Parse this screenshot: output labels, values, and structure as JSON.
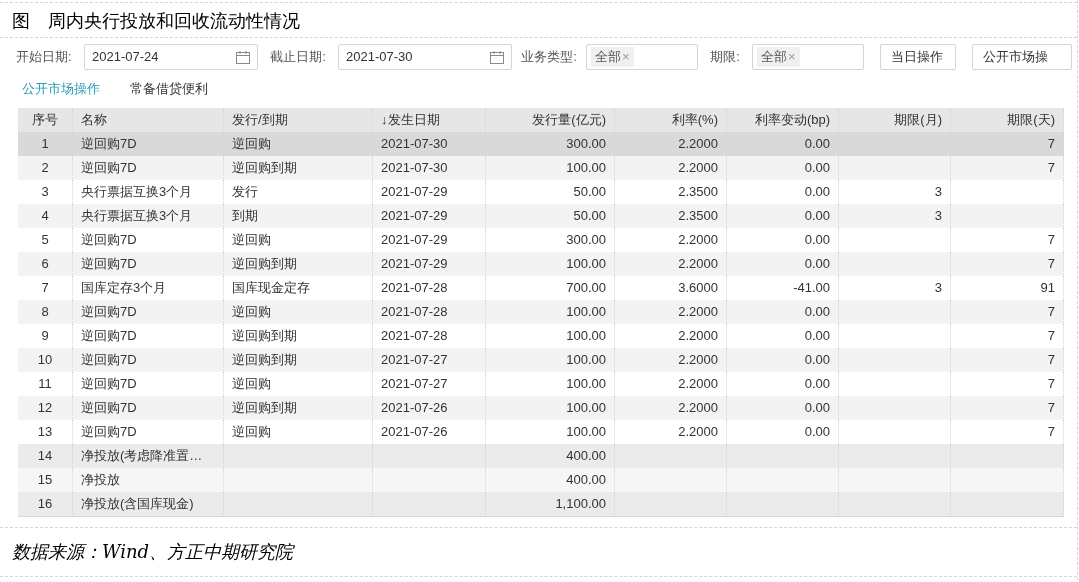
{
  "caption": "图　周内央行投放和回收流动性情况",
  "filters": [
    {
      "kind": "date",
      "label": "开始日期:",
      "value": "2021-07-24"
    },
    {
      "kind": "date",
      "label": "截止日期:",
      "value": "2021-07-30"
    },
    {
      "kind": "tag",
      "label": "业务类型:",
      "value": "全部",
      "remove": "×"
    },
    {
      "kind": "tag",
      "label": "期限:",
      "value": "全部",
      "remove": "×"
    }
  ],
  "buttons": [
    "当日操作",
    "公开市场操"
  ],
  "tabs": [
    {
      "label": "公开市场操作",
      "selected": true
    },
    {
      "label": "常备借贷便利",
      "selected": false
    }
  ],
  "table": {
    "columns": [
      "序号",
      "名称",
      "发行/到期",
      "↓发生日期",
      "发行量(亿元)",
      "利率(%)",
      "利率变动(bp)",
      "期限(月)",
      "期限(天)"
    ],
    "rows": [
      {
        "kind": "data",
        "selected": true,
        "cells": [
          "1",
          "逆回购7D",
          "逆回购",
          "2021-07-30",
          "300.00",
          "2.2000",
          "0.00",
          "",
          "7"
        ]
      },
      {
        "kind": "data",
        "selected": false,
        "cells": [
          "2",
          "逆回购7D",
          "逆回购到期",
          "2021-07-30",
          "100.00",
          "2.2000",
          "0.00",
          "",
          "7"
        ]
      },
      {
        "kind": "data",
        "selected": false,
        "cells": [
          "3",
          "央行票据互换3个月",
          "发行",
          "2021-07-29",
          "50.00",
          "2.3500",
          "0.00",
          "3",
          ""
        ]
      },
      {
        "kind": "data",
        "selected": false,
        "cells": [
          "4",
          "央行票据互换3个月",
          "到期",
          "2021-07-29",
          "50.00",
          "2.3500",
          "0.00",
          "3",
          ""
        ]
      },
      {
        "kind": "data",
        "selected": false,
        "cells": [
          "5",
          "逆回购7D",
          "逆回购",
          "2021-07-29",
          "300.00",
          "2.2000",
          "0.00",
          "",
          "7"
        ]
      },
      {
        "kind": "data",
        "selected": false,
        "cells": [
          "6",
          "逆回购7D",
          "逆回购到期",
          "2021-07-29",
          "100.00",
          "2.2000",
          "0.00",
          "",
          "7"
        ]
      },
      {
        "kind": "data",
        "selected": false,
        "cells": [
          "7",
          "国库定存3个月",
          "国库现金定存",
          "2021-07-28",
          "700.00",
          "3.6000",
          "-41.00",
          "3",
          "91"
        ]
      },
      {
        "kind": "data",
        "selected": false,
        "cells": [
          "8",
          "逆回购7D",
          "逆回购",
          "2021-07-28",
          "100.00",
          "2.2000",
          "0.00",
          "",
          "7"
        ]
      },
      {
        "kind": "data",
        "selected": false,
        "cells": [
          "9",
          "逆回购7D",
          "逆回购到期",
          "2021-07-28",
          "100.00",
          "2.2000",
          "0.00",
          "",
          "7"
        ]
      },
      {
        "kind": "data",
        "selected": false,
        "cells": [
          "10",
          "逆回购7D",
          "逆回购到期",
          "2021-07-27",
          "100.00",
          "2.2000",
          "0.00",
          "",
          "7"
        ]
      },
      {
        "kind": "data",
        "selected": false,
        "cells": [
          "11",
          "逆回购7D",
          "逆回购",
          "2021-07-27",
          "100.00",
          "2.2000",
          "0.00",
          "",
          "7"
        ]
      },
      {
        "kind": "data",
        "selected": false,
        "cells": [
          "12",
          "逆回购7D",
          "逆回购到期",
          "2021-07-26",
          "100.00",
          "2.2000",
          "0.00",
          "",
          "7"
        ]
      },
      {
        "kind": "data",
        "selected": false,
        "cells": [
          "13",
          "逆回购7D",
          "逆回购",
          "2021-07-26",
          "100.00",
          "2.2000",
          "0.00",
          "",
          "7"
        ]
      },
      {
        "kind": "summary",
        "selected": false,
        "cells": [
          "14",
          "净投放(考虑降准置…",
          "",
          "",
          "400.00",
          "",
          "",
          "",
          ""
        ]
      },
      {
        "kind": "summary",
        "selected": false,
        "cells": [
          "15",
          "净投放",
          "",
          "",
          "400.00",
          "",
          "",
          "",
          ""
        ]
      },
      {
        "kind": "summary",
        "selected": false,
        "cells": [
          "16",
          "净投放(含国库现金)",
          "",
          "",
          "1,100.00",
          "",
          "",
          "",
          ""
        ]
      }
    ]
  },
  "source": "数据来源：Wind、方正中期研究院"
}
